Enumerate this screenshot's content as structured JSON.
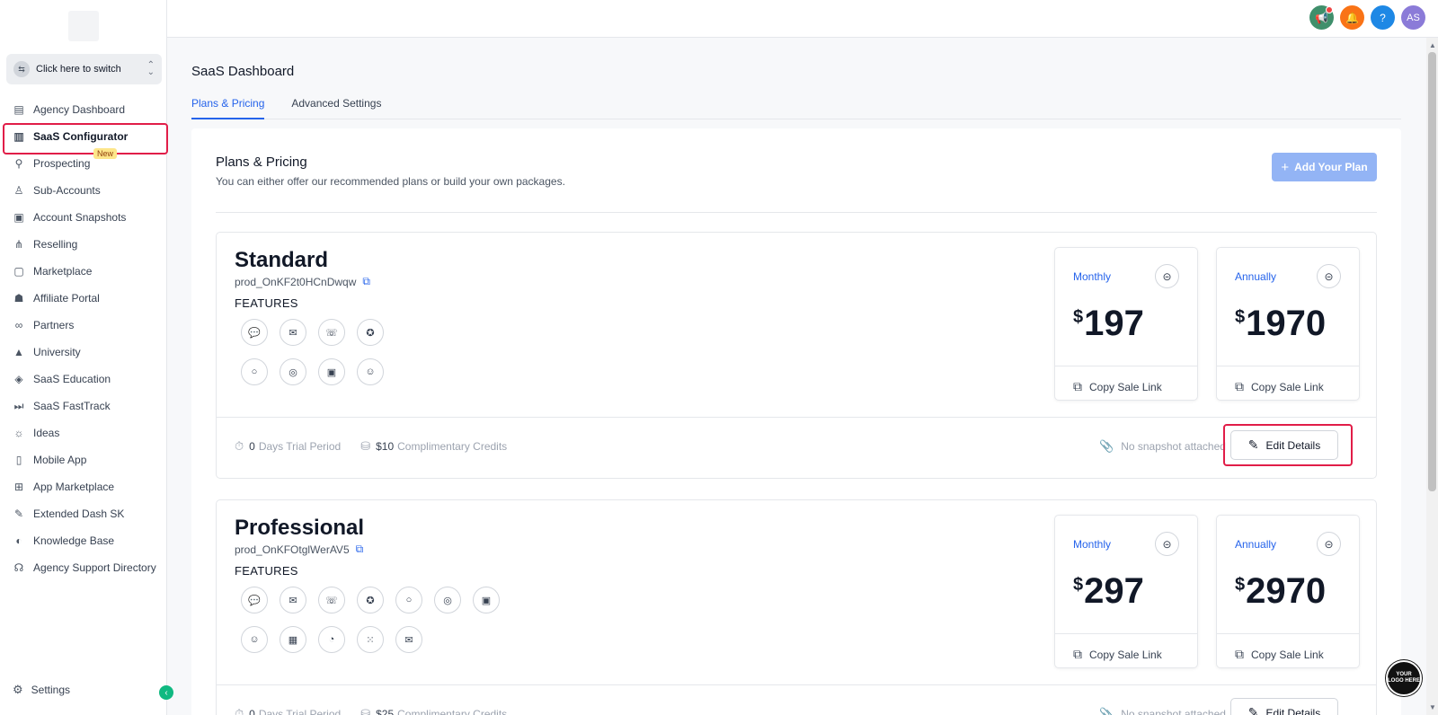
{
  "sidebar": {
    "switcher_label": "Click here to switch",
    "items": [
      {
        "label": "Agency Dashboard",
        "icon": "dashboard-icon"
      },
      {
        "label": "SaaS Configurator",
        "icon": "bar-chart-icon"
      },
      {
        "label": "Prospecting",
        "icon": "prospecting-icon",
        "badge": "New"
      },
      {
        "label": "Sub-Accounts",
        "icon": "user-icon"
      },
      {
        "label": "Account Snapshots",
        "icon": "snapshot-icon"
      },
      {
        "label": "Reselling",
        "icon": "reselling-icon"
      },
      {
        "label": "Marketplace",
        "icon": "bag-icon"
      },
      {
        "label": "Affiliate Portal",
        "icon": "users-icon"
      },
      {
        "label": "Partners",
        "icon": "handshake-icon"
      },
      {
        "label": "University",
        "icon": "graduation-cap-icon"
      },
      {
        "label": "SaaS Education",
        "icon": "box-icon"
      },
      {
        "label": "SaaS FastTrack",
        "icon": "fast-forward-icon"
      },
      {
        "label": "Ideas",
        "icon": "lightbulb-icon"
      },
      {
        "label": "Mobile App",
        "icon": "phone-icon"
      },
      {
        "label": "App Marketplace",
        "icon": "grid-icon"
      },
      {
        "label": "Extended Dash SK",
        "icon": "wrench-icon"
      },
      {
        "label": "Knowledge Base",
        "icon": "brain-icon"
      },
      {
        "label": "Agency Support Directory",
        "icon": "headset-icon"
      }
    ],
    "settings_label": "Settings"
  },
  "topbar": {
    "avatar_initials": "AS"
  },
  "header": {
    "title": "SaaS Dashboard",
    "tabs": [
      {
        "label": "Plans & Pricing",
        "active": true
      },
      {
        "label": "Advanced Settings",
        "active": false
      }
    ]
  },
  "panel": {
    "title": "Plans & Pricing",
    "subtitle": "You can either offer our recommended plans or build your own packages.",
    "add_plan_label": "Add Your Plan"
  },
  "plans": [
    {
      "name": "Standard",
      "product_id": "prod_OnKF2t0HCnDwqw",
      "features_label": "FEATURES",
      "feature_icons": [
        "chat-icon",
        "message-icon",
        "phone-chat-icon",
        "award-icon",
        "comment-icon",
        "target-icon",
        "screen-chat-icon",
        "review-icon"
      ],
      "monthly": {
        "period": "Monthly",
        "currency": "$",
        "price": "197",
        "copy_label": "Copy Sale Link"
      },
      "annual": {
        "period": "Annually",
        "currency": "$",
        "price": "1970",
        "copy_label": "Copy Sale Link"
      },
      "trial_days": "0",
      "trial_label": "Days Trial Period",
      "credits": "$10",
      "credits_label": "Complimentary Credits",
      "snapshot_label": "No snapshot attached",
      "edit_label": "Edit Details"
    },
    {
      "name": "Professional",
      "product_id": "prod_OnKFOtglWerAV5",
      "features_label": "FEATURES",
      "feature_icons": [
        "chat-icon",
        "message-icon",
        "phone-chat-icon",
        "award-icon",
        "comment-icon",
        "target-icon",
        "screen-chat-icon",
        "review-icon",
        "calendar-icon",
        "pie-chart-icon",
        "workflow-icon",
        "mail-icon"
      ],
      "monthly": {
        "period": "Monthly",
        "currency": "$",
        "price": "297",
        "copy_label": "Copy Sale Link"
      },
      "annual": {
        "period": "Annually",
        "currency": "$",
        "price": "2970",
        "copy_label": "Copy Sale Link"
      },
      "trial_days": "0",
      "trial_label": "Days Trial Period",
      "credits": "$25",
      "credits_label": "Complimentary Credits",
      "snapshot_label": "No snapshot attached",
      "edit_label": "Edit Details"
    }
  ],
  "widget": {
    "logo_text": "YOUR LOGO HERE"
  }
}
